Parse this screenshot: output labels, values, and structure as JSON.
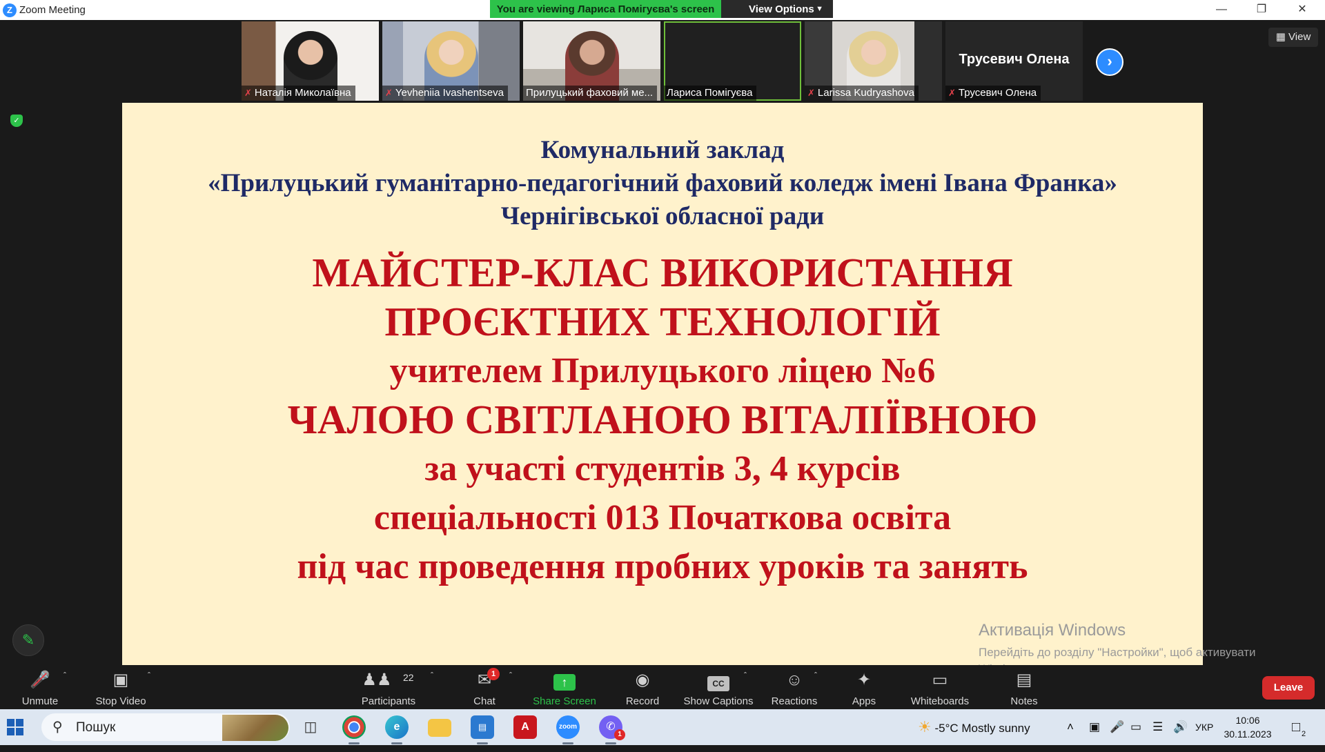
{
  "titlebar": {
    "app_title": "Zoom Meeting"
  },
  "banner": {
    "viewing_text": "You are viewing Лариса Помігуєва's screen",
    "view_options": "View Options"
  },
  "participants_strip": [
    {
      "name": "Наталія Миколаївна",
      "muted": true
    },
    {
      "name": "Yevheniia Ivashentseva",
      "muted": true
    },
    {
      "name": "Прилуцький фаховий ме...",
      "muted": false
    },
    {
      "name": "Лариса Помігуєва",
      "muted": false
    },
    {
      "name": "Larissa Kudryashova",
      "muted": true
    },
    {
      "name": "Трусевич Олена",
      "muted": true,
      "display_name": "Трусевич Олена"
    }
  ],
  "view_button": "View",
  "slide": {
    "header_lines": [
      "Комунальний заклад",
      "«Прилуцький гуманітарно-педагогічний фаховий коледж імені Івана Франка»",
      "Чернігівської обласної ради"
    ],
    "red_lines": [
      "МАЙСТЕР-КЛАС ВИКОРИСТАННЯ",
      "ПРОЄКТНИХ ТЕХНОЛОГІЙ",
      "учителем Прилуцького ліцею №6",
      "ЧАЛОЮ СВІТЛАНОЮ ВІТАЛІЇВНОЮ",
      "за участі студентів 3, 4 курсів",
      "спеціальності 013 Початкова освіта",
      "під час проведення пробних уроків та занять"
    ]
  },
  "activation": {
    "title": "Активація Windows",
    "message": "Перейдіть до розділу \"Настройки\", щоб активувати Windows."
  },
  "toolbar": {
    "unmute": "Unmute",
    "stop_video": "Stop Video",
    "participants": "Participants",
    "participants_count": "22",
    "chat": "Chat",
    "chat_badge": "1",
    "share_screen": "Share Screen",
    "record": "Record",
    "show_captions": "Show Captions",
    "reactions": "Reactions",
    "apps": "Apps",
    "whiteboards": "Whiteboards",
    "notes": "Notes",
    "leave": "Leave"
  },
  "taskbar": {
    "search_placeholder": "Пошук",
    "weather": "-5°C  Mostly sunny",
    "lang": "УКР",
    "time": "10:06",
    "date": "30.11.2023",
    "notif_count": "2",
    "viber_badge": "1"
  },
  "colors": {
    "slide_bg": "#fff2cc",
    "header_text": "#1f2a66",
    "red_text": "#c0111b",
    "zoom_blue": "#2d8cff",
    "share_green": "#2dc24a",
    "leave_red": "#d52b2b"
  }
}
